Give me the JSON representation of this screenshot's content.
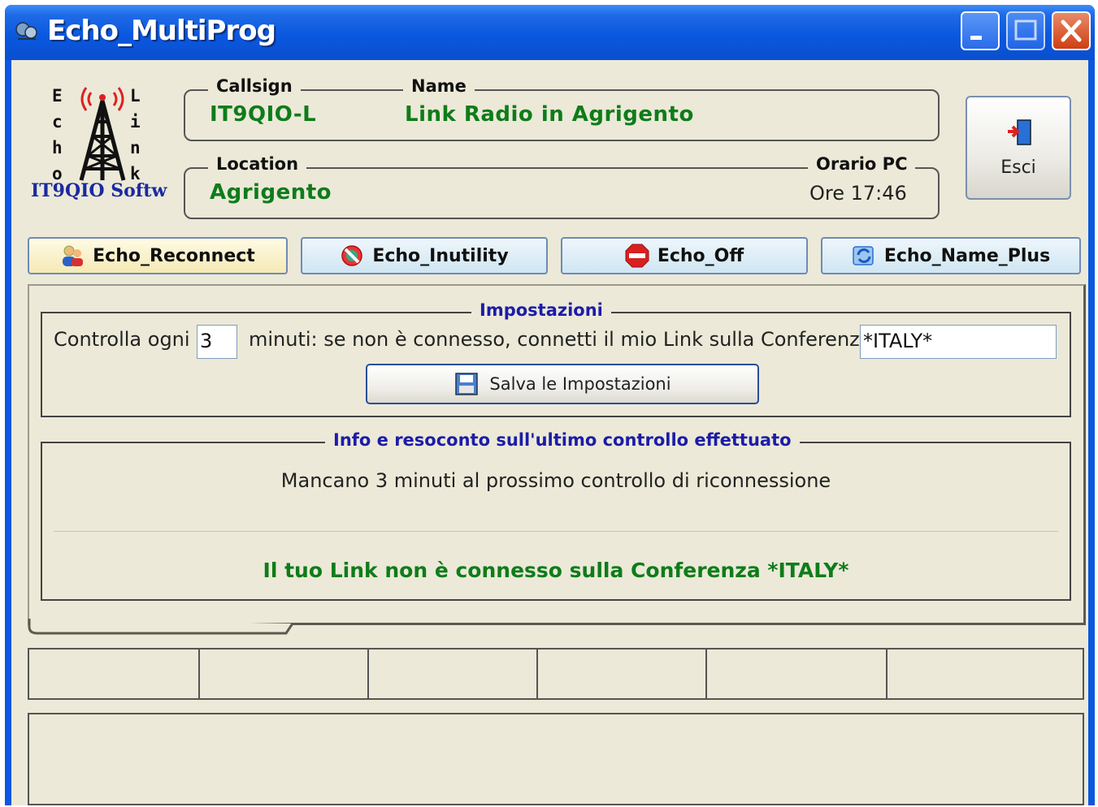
{
  "window": {
    "title": "Echo_MultiProg"
  },
  "logo": {
    "left_letters": [
      "E",
      "c",
      "h",
      "o"
    ],
    "right_letters": [
      "L",
      "i",
      "n",
      "k"
    ],
    "caption": "IT9QIO Softw"
  },
  "header": {
    "callsign_label": "Callsign",
    "callsign_value": "IT9QIO-L",
    "name_label": "Name",
    "name_value": "Link Radio in Agrigento",
    "location_label": "Location",
    "location_value": "Agrigento",
    "clock_label": "Orario PC",
    "clock_value": "Ore 17:46"
  },
  "exit_button": {
    "label": "Esci"
  },
  "tabs": [
    {
      "label": "Echo_Reconnect",
      "active": true
    },
    {
      "label": "Echo_Inutility",
      "active": false
    },
    {
      "label": "Echo_Off",
      "active": false
    },
    {
      "label": "Echo_Name_Plus",
      "active": false
    }
  ],
  "settings": {
    "title": "Impostazioni",
    "check_prefix": "Controlla ogni",
    "minutes_value": "3",
    "check_suffix": "minuti: se non è connesso, connetti il mio Link sulla Conferenza",
    "conference_value": "*ITALY*",
    "save_label": "Salva le Impostazioni"
  },
  "info": {
    "title": "Info e resoconto sull'ultimo controllo effettuato",
    "countdown": "Mancano 3 minuti al prossimo controllo di riconnessione",
    "status": "Il tuo Link non è connesso sulla Conferenza *ITALY*"
  },
  "colors": {
    "titlebar": "#0a58df",
    "face": "#ece9d8",
    "green_text": "#0e7c1a",
    "section_title": "#1c1ca8"
  }
}
